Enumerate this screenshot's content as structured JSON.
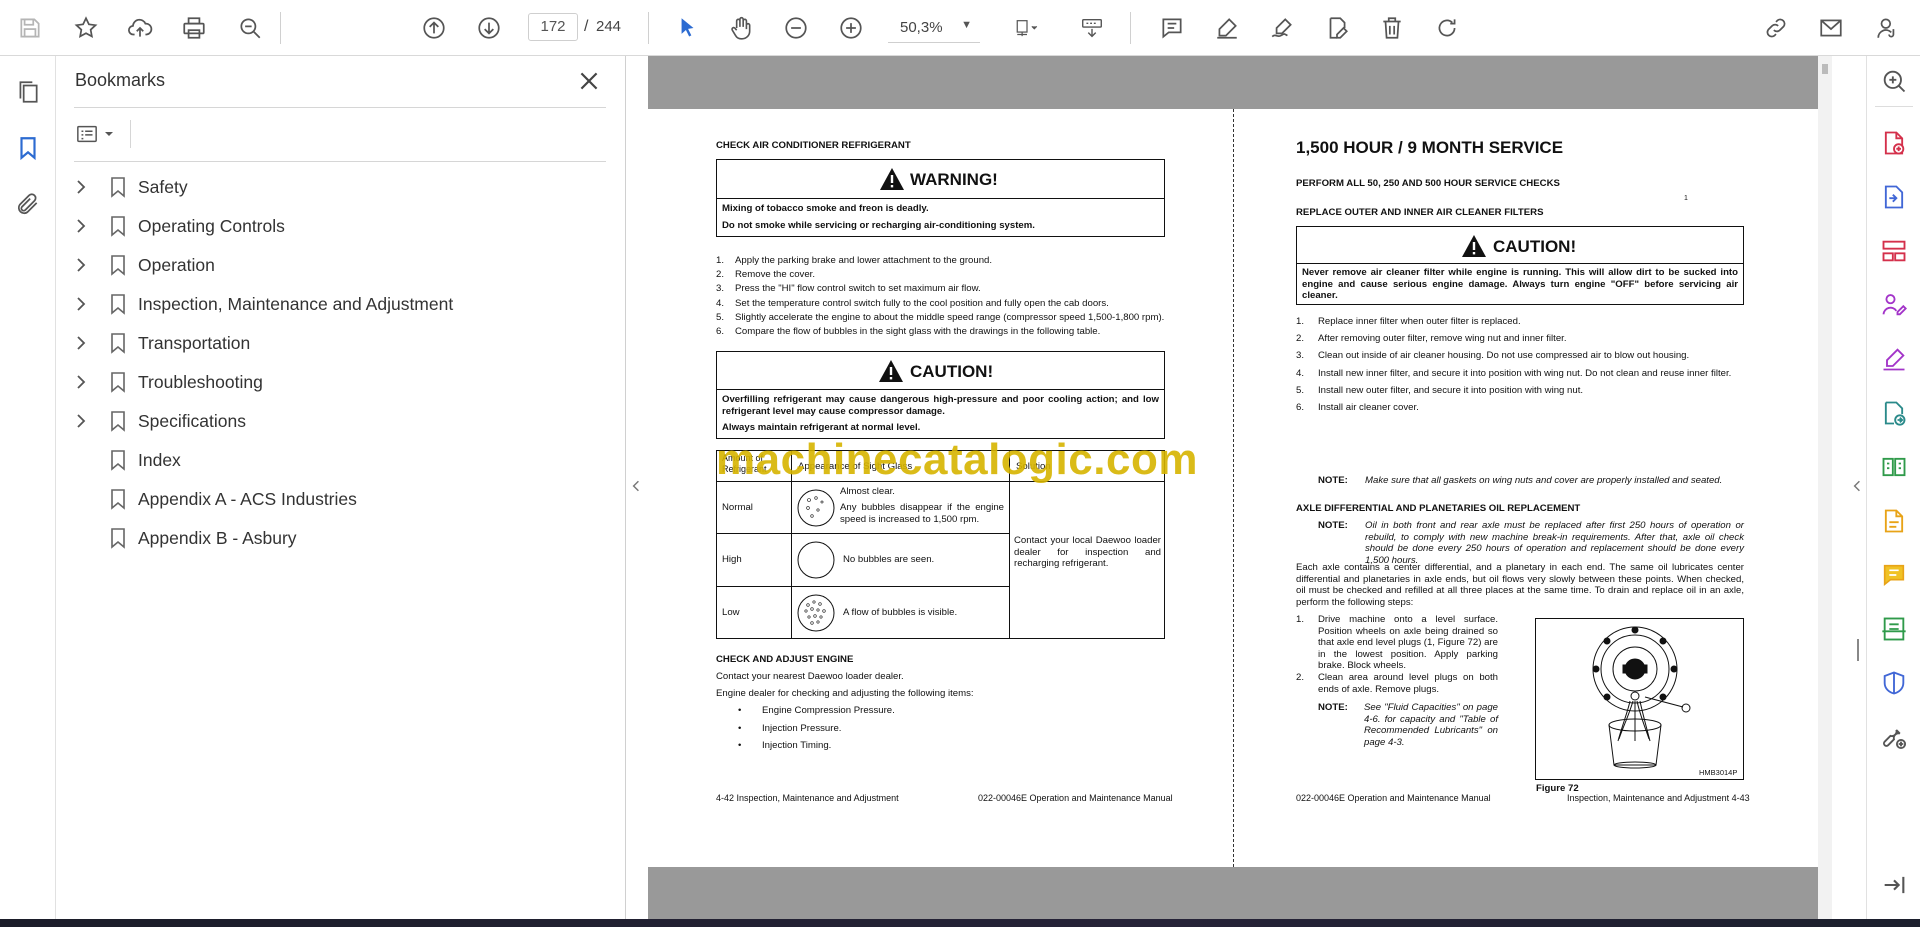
{
  "toolbar": {
    "page_current": "172",
    "page_total": "244",
    "zoom": "50,3%"
  },
  "bookmarks": {
    "title": "Bookmarks",
    "items": [
      {
        "label": "Safety",
        "expandable": true
      },
      {
        "label": "Operating Controls",
        "expandable": true
      },
      {
        "label": "Operation",
        "expandable": true
      },
      {
        "label": "Inspection, Maintenance and Adjustment",
        "expandable": true
      },
      {
        "label": "Transportation",
        "expandable": true
      },
      {
        "label": "Troubleshooting",
        "expandable": true
      },
      {
        "label": "Specifications",
        "expandable": true
      },
      {
        "label": "Index",
        "expandable": false
      },
      {
        "label": "Appendix A - ACS Industries",
        "expandable": false
      },
      {
        "label": "Appendix B - Asbury",
        "expandable": false
      }
    ]
  },
  "left_page": {
    "heading": "CHECK AIR CONDITIONER REFRIGERANT",
    "warning_title": "WARNING!",
    "warning_line1": "Mixing of tobacco smoke and freon is deadly.",
    "warning_line2": "Do not smoke while servicing or recharging air-conditioning system.",
    "steps": [
      "Apply the parking brake and lower attachment to the ground.",
      "Remove the cover.",
      "Press the \"HI\" flow control switch to set maximum air flow.",
      "Set the temperature control switch fully to the cool position and fully open the cab doors.",
      "Slightly accelerate the engine to about the middle speed range (compressor speed 1,500-1,800 rpm).",
      "Compare the flow of bubbles in the sight glass with the drawings in the following table."
    ],
    "caution_title": "CAUTION!",
    "caution_text": "Overfilling refrigerant may cause dangerous high-pressure and poor cooling action; and low refrigerant level may cause compressor damage.",
    "caution_line2": "Always maintain refrigerant at normal level.",
    "table": {
      "col1_header": "Amount of Refrigerant",
      "col2_header": "Appearance of Sight Glass",
      "col3_header": "Solution",
      "rows": [
        {
          "amount": "Normal",
          "appearance1": "Almost clear.",
          "appearance2": "Any bubbles disappear if the engine speed is increased to 1,500 rpm."
        },
        {
          "amount": "High",
          "appearance1": "No bubbles are seen."
        },
        {
          "amount": "Low",
          "appearance1": "A flow of bubbles is visible."
        }
      ],
      "solution": "Contact your local Daewoo loader dealer for inspection and recharging refrigerant."
    },
    "engine_heading": "CHECK AND ADJUST ENGINE",
    "engine_line1": "Contact your nearest Daewoo loader dealer.",
    "engine_line2": "Engine dealer for checking and adjusting the following items:",
    "engine_items": [
      "Engine Compression Pressure.",
      "Injection Pressure.",
      "Injection Timing."
    ],
    "footer_left": "4-42  Inspection, Maintenance and Adjustment",
    "footer_right": "022-00046E Operation and Maintenance Manual"
  },
  "right_page": {
    "title": "1,500 HOUR / 9 MONTH SERVICE",
    "subheading": "PERFORM ALL 50, 250 AND 500 HOUR SERVICE CHECKS",
    "filter_heading": "REPLACE OUTER AND INNER AIR CLEANER FILTERS",
    "caution_title": "CAUTION!",
    "caution_text": "Never remove air cleaner filter while engine is running. This will allow dirt to be sucked into engine and cause serious engine damage. Always turn engine \"OFF\" before servicing air cleaner.",
    "steps": [
      "Replace inner filter when outer filter is replaced.",
      "After removing outer filter, remove wing nut and inner filter.",
      "Clean out inside of air cleaner housing. Do not use compressed air to blow out housing.",
      "Install new inner filter, and secure it into position with wing nut. Do not clean and reuse inner filter.",
      "Install new outer filter, and secure it into position with wing nut.",
      "Install air cleaner cover."
    ],
    "note1_label": "NOTE:",
    "note1_text": "Make sure that all gaskets on wing nuts and cover are properly installed and seated.",
    "axle_heading": "AXLE DIFFERENTIAL AND PLANETARIES OIL REPLACEMENT",
    "note2_label": "NOTE:",
    "note2_text": "Oil in both front and rear axle must be replaced after first 250 hours of operation or rebuild, to comply with new machine break-in requirements. After that, axle oil check should be done every 250 hours of operation and replacement should be done every 1,500 hours.",
    "axle_para": "Each axle contains a center differential, and a planetary in each end. The same oil lubricates center differential and planetaries in axle ends, but oil flows very slowly between these points. When checked, oil must be checked and refilled at all three places at the same time. To drain and replace oil in an axle, perform the following steps:",
    "axle_steps": [
      "Drive machine onto a level surface. Position wheels on axle being drained so that axle end level plugs (1, Figure 72) are in the lowest position. Apply parking brake. Block wheels.",
      "Clean area around level plugs on both ends of axle. Remove plugs."
    ],
    "note3_label": "NOTE:",
    "note3_text": "See \"Fluid Capacities\" on page 4-6. for capacity and \"Table of Recommended Lubricants\" on page 4-3.",
    "figure_code": "HMB3014P",
    "figure_caption": "Figure 72",
    "callout": "1",
    "footer_left": "022-00046E Operation and Maintenance Manual",
    "footer_right": "Inspection, Maintenance and Adjustment 4-43"
  },
  "watermark": "machinecatalogic.com",
  "colors": {
    "accent": "#2c6bd1",
    "rail_icon": "#b3206b",
    "icon_gray": "#5c5c5c"
  }
}
